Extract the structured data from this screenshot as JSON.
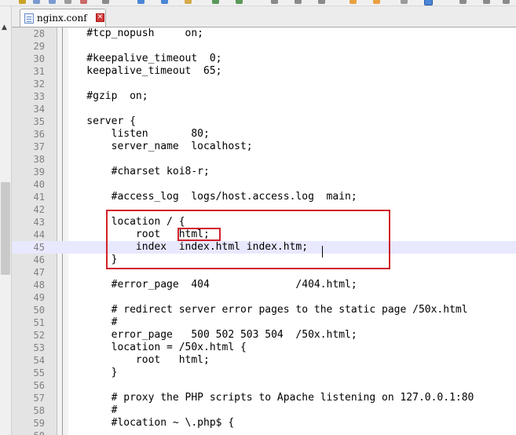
{
  "tab": {
    "label": "nginx.conf",
    "close_glyph": "✕",
    "icon": "document-icon"
  },
  "editor": {
    "current_line": 45,
    "highlight_color": "#d0202a",
    "lines": [
      {
        "n": "28",
        "text": "    #tcp_nopush     on;"
      },
      {
        "n": "29",
        "text": ""
      },
      {
        "n": "30",
        "text": "    #keepalive_timeout  0;"
      },
      {
        "n": "31",
        "text": "    keepalive_timeout  65;"
      },
      {
        "n": "32",
        "text": ""
      },
      {
        "n": "33",
        "text": "    #gzip  on;"
      },
      {
        "n": "34",
        "text": ""
      },
      {
        "n": "35",
        "text": "    server {"
      },
      {
        "n": "36",
        "text": "        listen       80;"
      },
      {
        "n": "37",
        "text": "        server_name  localhost;"
      },
      {
        "n": "38",
        "text": ""
      },
      {
        "n": "39",
        "text": "        #charset koi8-r;"
      },
      {
        "n": "40",
        "text": ""
      },
      {
        "n": "41",
        "text": "        #access_log  logs/host.access.log  main;"
      },
      {
        "n": "42",
        "text": ""
      },
      {
        "n": "43",
        "text": "        location / {"
      },
      {
        "n": "44",
        "text": "            root   html;"
      },
      {
        "n": "45",
        "text": "            index  index.html index.htm;"
      },
      {
        "n": "46",
        "text": "        }"
      },
      {
        "n": "47",
        "text": ""
      },
      {
        "n": "48",
        "text": "        #error_page  404              /404.html;"
      },
      {
        "n": "49",
        "text": ""
      },
      {
        "n": "50",
        "text": "        # redirect server error pages to the static page /50x.html"
      },
      {
        "n": "51",
        "text": "        #"
      },
      {
        "n": "52",
        "text": "        error_page   500 502 503 504  /50x.html;"
      },
      {
        "n": "53",
        "text": "        location = /50x.html {"
      },
      {
        "n": "54",
        "text": "            root   html;"
      },
      {
        "n": "55",
        "text": "        }"
      },
      {
        "n": "56",
        "text": ""
      },
      {
        "n": "57",
        "text": "        # proxy the PHP scripts to Apache listening on 127.0.0.1:80"
      },
      {
        "n": "58",
        "text": "        #"
      },
      {
        "n": "59",
        "text": "        #location ~ \\.php$ {"
      },
      {
        "n": "60",
        "text": ""
      }
    ]
  }
}
